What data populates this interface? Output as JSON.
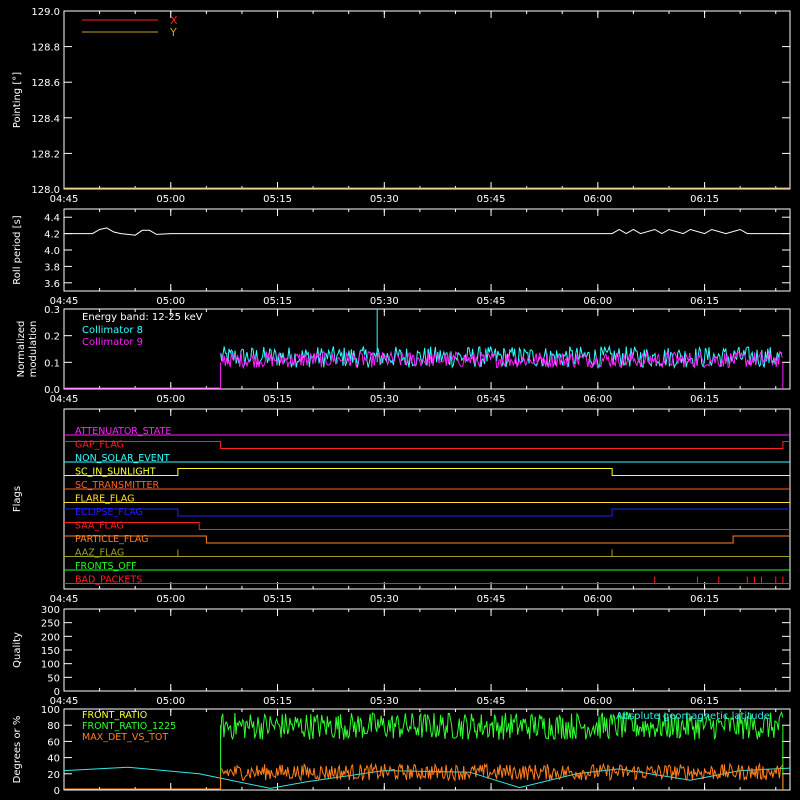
{
  "chart_data": [
    {
      "type": "line",
      "ylabel": "Pointing [°]",
      "ylim": [
        128.0,
        129.0
      ],
      "yticks": [
        "128.0",
        "128.2",
        "128.4",
        "128.6",
        "128.8",
        "129.0"
      ],
      "xticks": [
        "04:45",
        "05:00",
        "05:15",
        "05:30",
        "05:45",
        "06:00",
        "06:15"
      ],
      "series": [
        {
          "name": "X",
          "color": "#ff2020",
          "x": [
            "04:45",
            "06:27"
          ],
          "values": [
            128.0,
            128.0
          ]
        },
        {
          "name": "Y",
          "color": "#c8a020",
          "x": [
            "04:45",
            "06:27"
          ],
          "values": [
            128.0,
            128.0
          ]
        }
      ]
    },
    {
      "type": "line",
      "ylabel": "Roll period [s]",
      "ylim": [
        3.5,
        4.5
      ],
      "yticks": [
        "3.6",
        "3.8",
        "4.0",
        "4.2",
        "4.4"
      ],
      "xticks": [
        "04:45",
        "05:00",
        "05:15",
        "05:30",
        "05:45",
        "06:00",
        "06:15"
      ],
      "series": [
        {
          "color": "#ffffff",
          "x": [
            "04:45",
            "04:49",
            "04:50",
            "04:51",
            "04:52",
            "04:53",
            "04:55",
            "04:56",
            "04:57",
            "04:58",
            "05:00",
            "05:01",
            "06:02",
            "06:03",
            "06:04",
            "06:05",
            "06:06",
            "06:08",
            "06:09",
            "06:10",
            "06:12",
            "06:13",
            "06:15",
            "06:16",
            "06:18",
            "06:20",
            "06:21",
            "06:23",
            "06:27"
          ],
          "values": [
            4.2,
            4.2,
            4.25,
            4.27,
            4.22,
            4.2,
            4.18,
            4.24,
            4.24,
            4.19,
            4.2,
            4.2,
            4.2,
            4.25,
            4.2,
            4.25,
            4.2,
            4.25,
            4.2,
            4.25,
            4.2,
            4.25,
            4.2,
            4.25,
            4.2,
            4.25,
            4.2,
            4.2,
            4.2
          ]
        }
      ]
    },
    {
      "type": "line",
      "ylabel": "Normalized modulation",
      "ylim": [
        0.0,
        0.3
      ],
      "yticks": [
        "0.0",
        "0.1",
        "0.2",
        "0.3"
      ],
      "xticks": [
        "04:45",
        "05:00",
        "05:15",
        "05:30",
        "05:45",
        "06:00",
        "06:15"
      ],
      "annotation": "Energy band: 12-25 keV",
      "series": [
        {
          "name": "Collimator 8",
          "color": "#30ffff",
          "x": [
            "05:07",
            "06:26"
          ],
          "values": [
            0.11,
            0.11
          ],
          "noise_range": [
            0.08,
            0.16
          ]
        },
        {
          "name": "Collimator 9",
          "color": "#ff20ff",
          "x": [
            "05:07",
            "06:26"
          ],
          "values": [
            0.1,
            0.1
          ],
          "noise_range": [
            0.08,
            0.14
          ]
        }
      ]
    },
    {
      "type": "line",
      "ylabel": "Flags",
      "xticks": [
        "04:45",
        "05:00",
        "05:15",
        "05:30",
        "05:45",
        "06:00",
        "06:15"
      ],
      "series": [
        {
          "name": "ATTENUATOR_STATE",
          "color": "#ff20ff",
          "segments": [
            [
              "04:45",
              "06:27",
              0
            ]
          ]
        },
        {
          "name": "GAP_FLAG",
          "color": "#ff2020",
          "segments": [
            [
              "04:45",
              "05:07",
              1
            ],
            [
              "05:07",
              "06:26",
              0
            ],
            [
              "06:26",
              "06:27",
              1
            ]
          ]
        },
        {
          "name": "NON_SOLAR_EVENT",
          "color": "#30ffff",
          "segments": [
            [
              "04:45",
              "06:27",
              0
            ]
          ]
        },
        {
          "name": "SC_IN_SUNLIGHT",
          "color": "#ffff30",
          "segments": [
            [
              "04:45",
              "05:01",
              0
            ],
            [
              "05:01",
              "06:02",
              1
            ],
            [
              "06:02",
              "06:27",
              0
            ]
          ]
        },
        {
          "name": "SC_TRANSMITTER",
          "color": "#ff6020",
          "segments": [
            [
              "04:45",
              "06:27",
              0
            ]
          ]
        },
        {
          "name": "FLARE_FLAG",
          "color": "#ffe030",
          "segments": [
            [
              "04:45",
              "06:27",
              0
            ]
          ]
        },
        {
          "name": "ECLIPSE_FLAG",
          "color": "#2020ff",
          "segments": [
            [
              "04:45",
              "05:01",
              1
            ],
            [
              "05:01",
              "06:02",
              0
            ],
            [
              "06:02",
              "06:27",
              1
            ]
          ]
        },
        {
          "name": "SAA_FLAG",
          "color": "#ff2020",
          "segments": [
            [
              "04:45",
              "05:04",
              1
            ],
            [
              "05:04",
              "06:27",
              0
            ]
          ]
        },
        {
          "name": "PARTICLE_FLAG",
          "color": "#ff8020",
          "segments": [
            [
              "04:45",
              "05:05",
              1
            ],
            [
              "05:05",
              "06:19",
              0
            ],
            [
              "06:19",
              "06:27",
              1
            ]
          ]
        },
        {
          "name": "AAZ_FLAG",
          "color": "#a0a020",
          "segments": [
            [
              "04:45",
              "06:27",
              0
            ]
          ],
          "spikes": [
            "05:01",
            "06:02"
          ]
        },
        {
          "name": "FRONTS_OFF",
          "color": "#20ff20",
          "segments": [
            [
              "04:45",
              "06:27",
              0
            ]
          ]
        },
        {
          "name": "BAD_PACKETS",
          "color": "#ff2020",
          "segments": [
            [
              "04:45",
              "06:27",
              0
            ]
          ],
          "spikes": [
            "06:08",
            "06:14",
            "06:17",
            "06:21",
            "06:22",
            "06:23",
            "06:25",
            "06:26"
          ]
        }
      ]
    },
    {
      "type": "line",
      "ylabel": "Quality",
      "ylim": [
        0,
        300
      ],
      "yticks": [
        "0",
        "50",
        "100",
        "150",
        "200",
        "250",
        "300"
      ],
      "xticks": [
        "04:45",
        "05:00",
        "05:15",
        "05:30",
        "05:45",
        "06:00",
        "06:15"
      ],
      "series": []
    },
    {
      "type": "line",
      "ylabel": "Degrees or %",
      "ylim": [
        0,
        100
      ],
      "yticks": [
        "0",
        "20",
        "40",
        "60",
        "80",
        "100"
      ],
      "series": [
        {
          "name": "FRONT_RATIO",
          "color": "#ffff30",
          "x": [
            "05:07",
            "06:26"
          ],
          "values": [
            0,
            0
          ]
        },
        {
          "name": "FRONT_RATIO_1225",
          "color": "#30ff30",
          "x": [
            "05:07",
            "06:26"
          ],
          "values": [
            80,
            80
          ],
          "noise_range": [
            62,
            96
          ]
        },
        {
          "name": "MAX_DET_VS_TOT",
          "color": "#ff8020",
          "x": [
            "05:07",
            "06:26"
          ],
          "values": [
            20,
            20
          ],
          "noise_range": [
            12,
            32
          ]
        },
        {
          "name": "Absolute geomagnetic latitude",
          "color": "#30e8e8",
          "x": [
            "04:45",
            "04:54",
            "05:04",
            "05:14",
            "05:19",
            "05:30",
            "05:42",
            "05:49",
            "05:57",
            "06:03",
            "06:13",
            "06:20",
            "06:27"
          ],
          "values": [
            24,
            28,
            20,
            2,
            10,
            24,
            22,
            3,
            20,
            26,
            12,
            24,
            27
          ]
        }
      ]
    }
  ]
}
